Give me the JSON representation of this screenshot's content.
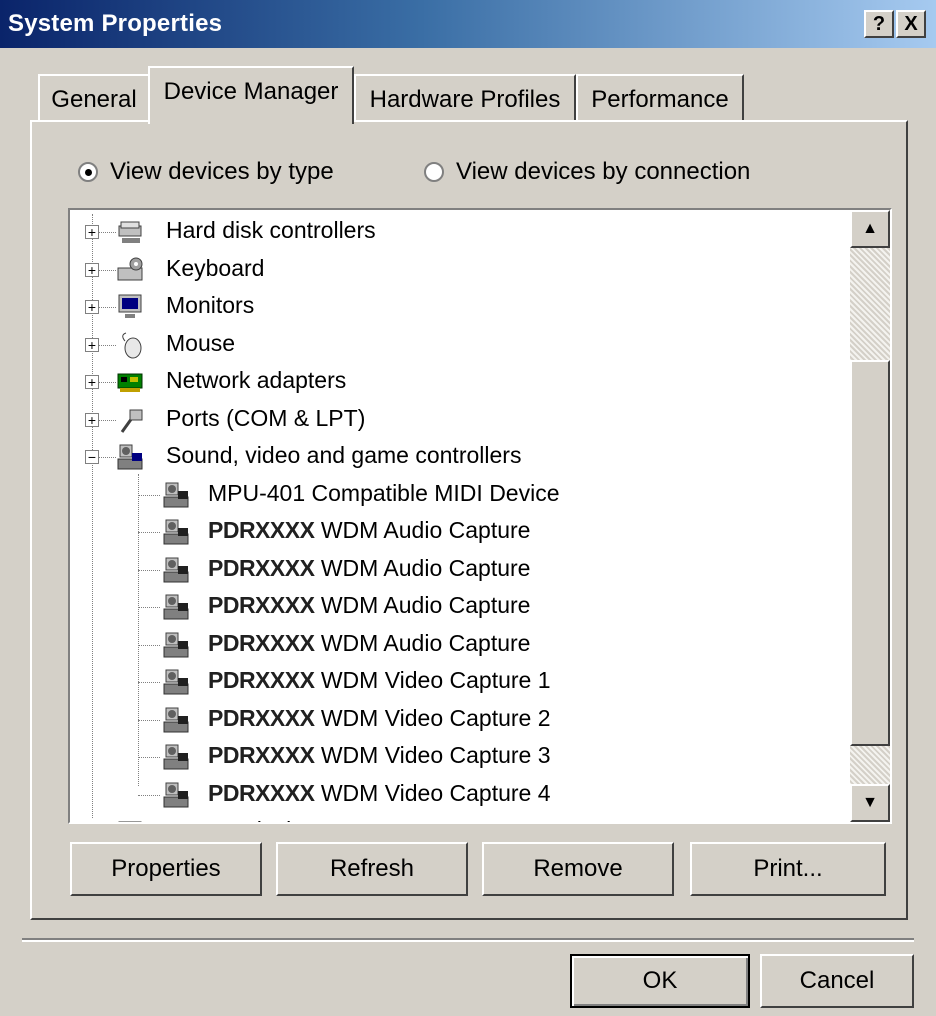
{
  "window": {
    "title": "System Properties",
    "help_button": "?",
    "close_button": "X"
  },
  "tabs": [
    {
      "label": "General"
    },
    {
      "label": "Device Manager"
    },
    {
      "label": "Hardware Profiles"
    },
    {
      "label": "Performance"
    }
  ],
  "view_options": {
    "by_type": "View devices by type",
    "by_connection": "View devices by connection",
    "selected": "by_type"
  },
  "tree": {
    "categories": [
      {
        "label": "Hard disk controllers",
        "icon": "disk-controller-icon",
        "expanded": false
      },
      {
        "label": "Keyboard",
        "icon": "keyboard-icon",
        "expanded": false
      },
      {
        "label": "Monitors",
        "icon": "monitor-icon",
        "expanded": false
      },
      {
        "label": "Mouse",
        "icon": "mouse-icon",
        "expanded": false
      },
      {
        "label": "Network adapters",
        "icon": "network-adapter-icon",
        "expanded": false
      },
      {
        "label": "Ports (COM & LPT)",
        "icon": "port-icon",
        "expanded": false
      },
      {
        "label": "Sound, video and game controllers",
        "icon": "sound-video-icon",
        "expanded": true
      }
    ],
    "devices": [
      {
        "prefix": "",
        "label": "MPU-401 Compatible MIDI Device"
      },
      {
        "prefix": "PDRXXXX",
        "label": " WDM Audio Capture"
      },
      {
        "prefix": "PDRXXXX",
        "label": " WDM Audio Capture"
      },
      {
        "prefix": "PDRXXXX",
        "label": " WDM Audio Capture"
      },
      {
        "prefix": "PDRXXXX",
        "label": " WDM Audio Capture"
      },
      {
        "prefix": "PDRXXXX",
        "label": " WDM Video Capture 1"
      },
      {
        "prefix": "PDRXXXX",
        "label": " WDM Video Capture 2"
      },
      {
        "prefix": "PDRXXXX",
        "label": " WDM Video Capture 3"
      },
      {
        "prefix": "PDRXXXX",
        "label": " WDM Video Capture 4"
      }
    ],
    "partial_next": "System devices"
  },
  "scrollbar": {
    "up": "▲",
    "down": "▼"
  },
  "actions": {
    "properties": "Properties",
    "refresh": "Refresh",
    "remove": "Remove",
    "print": "Print..."
  },
  "footer": {
    "ok": "OK",
    "cancel": "Cancel"
  }
}
